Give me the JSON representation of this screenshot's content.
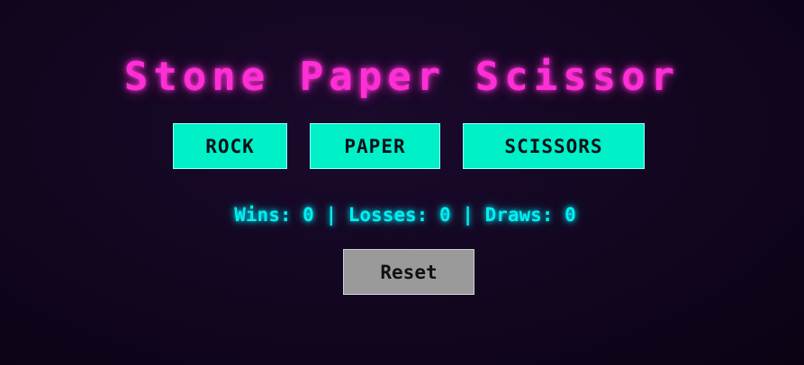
{
  "title": "Stone Paper Scissor",
  "choices": {
    "rock": "ROCK",
    "paper": "PAPER",
    "scissors": "SCISSORS"
  },
  "score": {
    "wins_label": "Wins:",
    "wins": "0",
    "losses_label": "Losses:",
    "losses": "0",
    "draws_label": "Draws:",
    "draws": "0",
    "separator": "|"
  },
  "reset_label": "Reset",
  "colors": {
    "title": "#ff2fd6",
    "choice_button": "#00f0c8",
    "score_text": "#00f0f0",
    "reset_button": "#9a9a9a",
    "background": "#12061f"
  }
}
